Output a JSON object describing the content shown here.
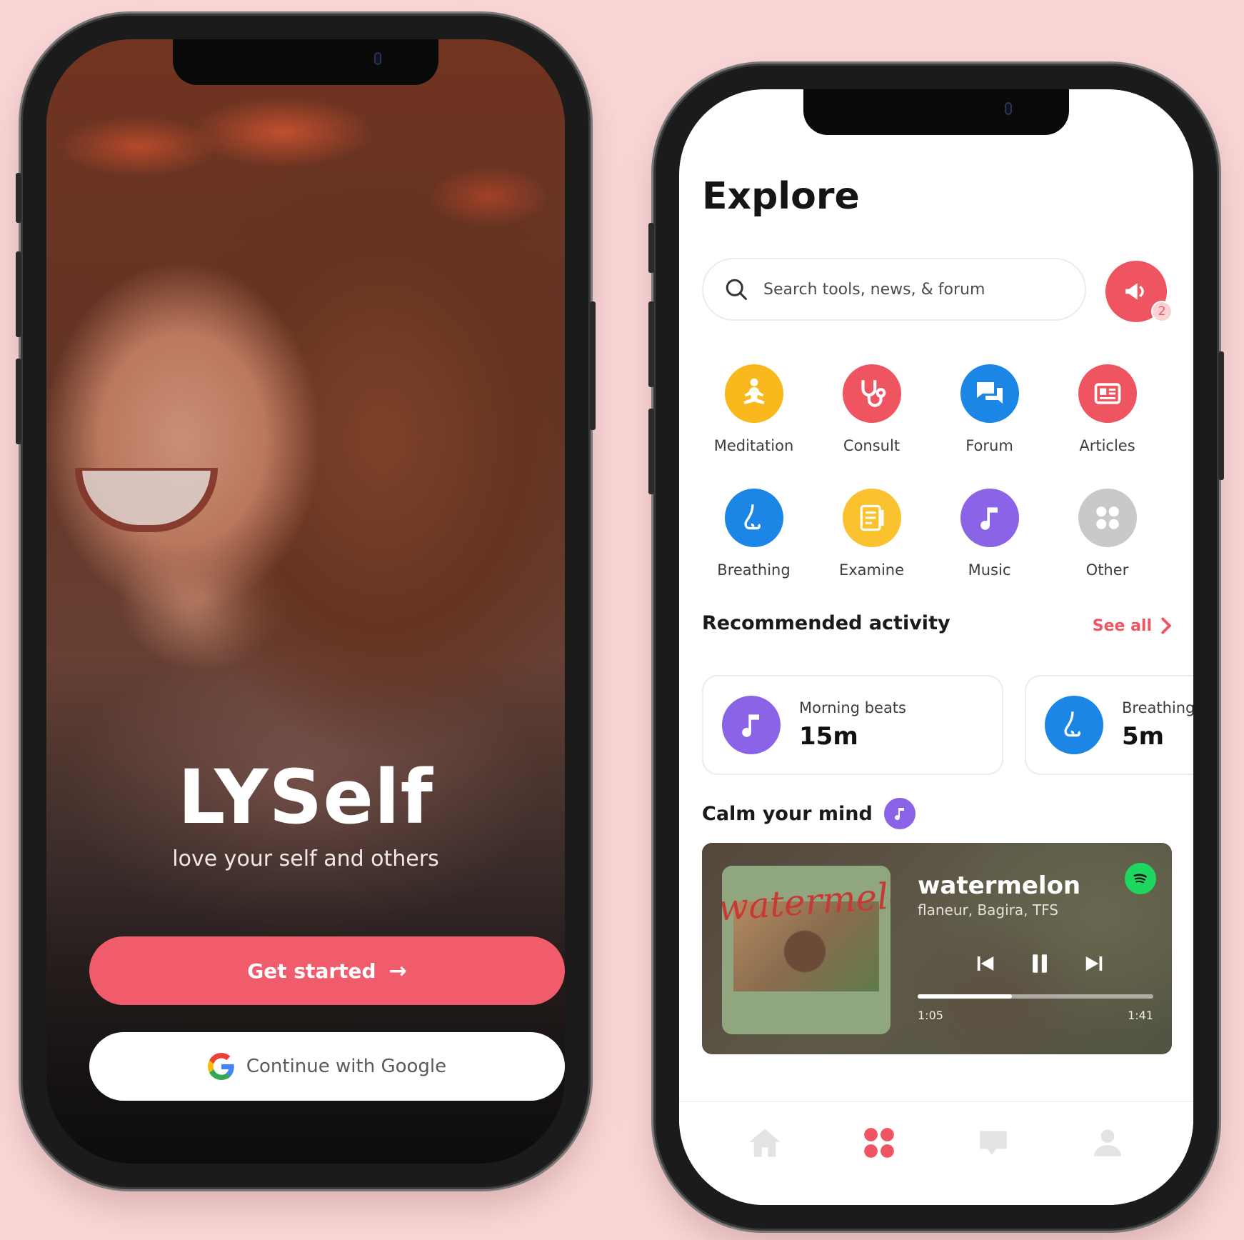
{
  "welcome": {
    "brand": "LYSelf",
    "tagline": "love your self and others",
    "get_started_label": "Get started",
    "google_label": "Continue with Google"
  },
  "explore": {
    "title": "Explore",
    "search_placeholder": "Search tools, news, & forum",
    "notification_count": "2",
    "categories": [
      {
        "label": "Meditation",
        "icon": "meditation-icon",
        "color": "#f9b81c"
      },
      {
        "label": "Consult",
        "icon": "stethoscope-icon",
        "color": "#ee5561"
      },
      {
        "label": "Forum",
        "icon": "chat-icon",
        "color": "#1b86e6"
      },
      {
        "label": "Articles",
        "icon": "newspaper-icon",
        "color": "#ee5561"
      },
      {
        "label": "Breathing",
        "icon": "nose-icon",
        "color": "#1b86e6"
      },
      {
        "label": "Examine",
        "icon": "checklist-icon",
        "color": "#f9c22e"
      },
      {
        "label": "Music",
        "icon": "music-note-icon",
        "color": "#8a63e6"
      },
      {
        "label": "Other",
        "icon": "grid-dots-icon",
        "color": "#c9c9c9"
      }
    ],
    "recommended": {
      "title": "Recommended activity",
      "see_all": "See all",
      "items": [
        {
          "name": "Morning beats",
          "duration": "15m",
          "icon": "music-note-icon",
          "color": "#8a63e6"
        },
        {
          "name": "Breathing",
          "duration": "5m",
          "icon": "nose-icon",
          "color": "#1b86e6"
        }
      ]
    },
    "calm": {
      "title": "Calm your mind",
      "album_text": "watermelon",
      "track": "watermelon",
      "artist": "flaneur, Bagira, TFS",
      "current_time": "1:05",
      "total_time": "1:41",
      "progress": 0.4
    },
    "tabs": [
      {
        "icon": "home-icon",
        "active": false
      },
      {
        "icon": "grid-dots-icon",
        "active": true
      },
      {
        "icon": "chat-bubble-icon",
        "active": false
      },
      {
        "icon": "profile-icon",
        "active": false
      }
    ]
  },
  "colors": {
    "accent": "#ee5561",
    "background": "#f9d6d6",
    "primary_button": "#f05c6c"
  }
}
